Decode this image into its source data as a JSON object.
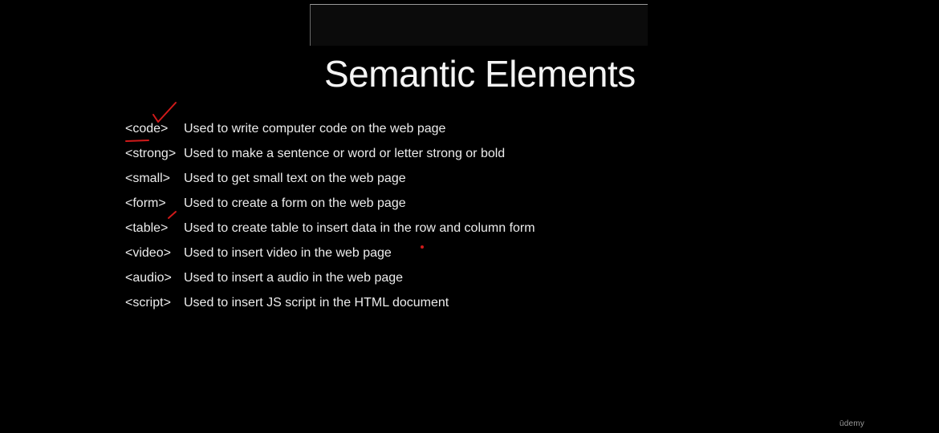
{
  "slide": {
    "title": "Semantic Elements",
    "elements": [
      {
        "tag": "<code>",
        "description": "Used to write computer code on the web page"
      },
      {
        "tag": "<strong>",
        "description": "Used to make a sentence or word or letter strong or bold"
      },
      {
        "tag": "<small>",
        "description": "Used to get small text on the web page"
      },
      {
        "tag": "<form>",
        "description": "Used to create a form on the web page"
      },
      {
        "tag": "<table>",
        "description": "Used to create table to insert data in the row and column form"
      },
      {
        "tag": "<video>",
        "description": "Used to insert video in the web page"
      },
      {
        "tag": "<audio>",
        "description": "Used to insert a audio in the web page"
      },
      {
        "tag": "<script>",
        "description": "Used to insert JS script in the HTML document"
      }
    ]
  },
  "watermark": "ūdemy",
  "colors": {
    "background": "#000000",
    "text": "#ececec",
    "annotation": "#d11a1a"
  }
}
